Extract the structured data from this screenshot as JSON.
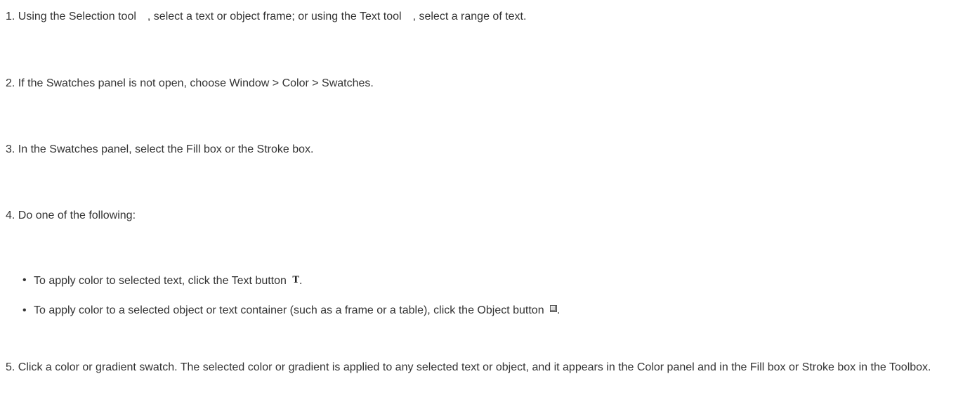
{
  "steps": {
    "s1": {
      "num": "1.",
      "a": "Using the Selection tool",
      "b": ", select a text or object frame; or using the Text tool",
      "c": ", select a range of text."
    },
    "s2": {
      "num": "2.",
      "text": "If the Swatches panel is not open, choose Window > Color > Swatches."
    },
    "s3": {
      "num": "3.",
      "text": "In the Swatches panel, select the Fill box or the Stroke box."
    },
    "s4": {
      "num": "4.",
      "text": "Do one of the following:"
    },
    "s5": {
      "num": "5.",
      "text": "Click a color or gradient swatch. The selected color or gradient is applied to any selected text or object, and it appears in the Color panel and in the Fill box or Stroke box in the Toolbox."
    }
  },
  "bullets": {
    "b1": {
      "text": "To apply color to selected text, click the Text button",
      "icon_glyph": "T",
      "icon": "text-button-icon",
      "end": "."
    },
    "b2": {
      "text": "To apply color to a selected object or text container (such as a frame or a table), click the Object button",
      "icon": "object-button-icon",
      "end": "."
    }
  }
}
